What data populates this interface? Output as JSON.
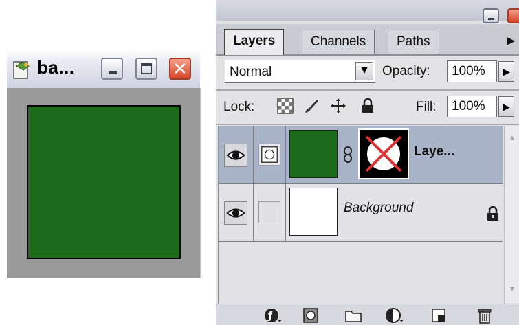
{
  "document_window": {
    "title": "ba...",
    "icon": "photoshop-document-icon",
    "buttons": {
      "minimize": "minimize-icon",
      "maximize": "maximize-icon",
      "close": "✕"
    },
    "canvas_fill_color": "#1b6b1b"
  },
  "panel": {
    "tabs": [
      {
        "label": "Layers",
        "active": true
      },
      {
        "label": "Channels",
        "active": false
      },
      {
        "label": "Paths",
        "active": false
      }
    ],
    "blend_mode": "Normal",
    "opacity_label": "Opacity:",
    "opacity_value": "100%",
    "lock_label": "Lock:",
    "fill_label": "Fill:",
    "fill_value": "100%",
    "layers": [
      {
        "name": "Laye...",
        "visible": true,
        "selected": true,
        "thumb_color": "#1b6b1b",
        "has_mask": true,
        "locked": false
      },
      {
        "name": "Background",
        "visible": true,
        "selected": false,
        "thumb_color": "#ffffff",
        "has_mask": false,
        "locked": true
      }
    ],
    "bottom_icons": [
      "link-layers-icon",
      "add-mask-icon",
      "new-group-icon",
      "adjustment-layer-icon",
      "new-layer-icon",
      "delete-layer-icon"
    ]
  }
}
